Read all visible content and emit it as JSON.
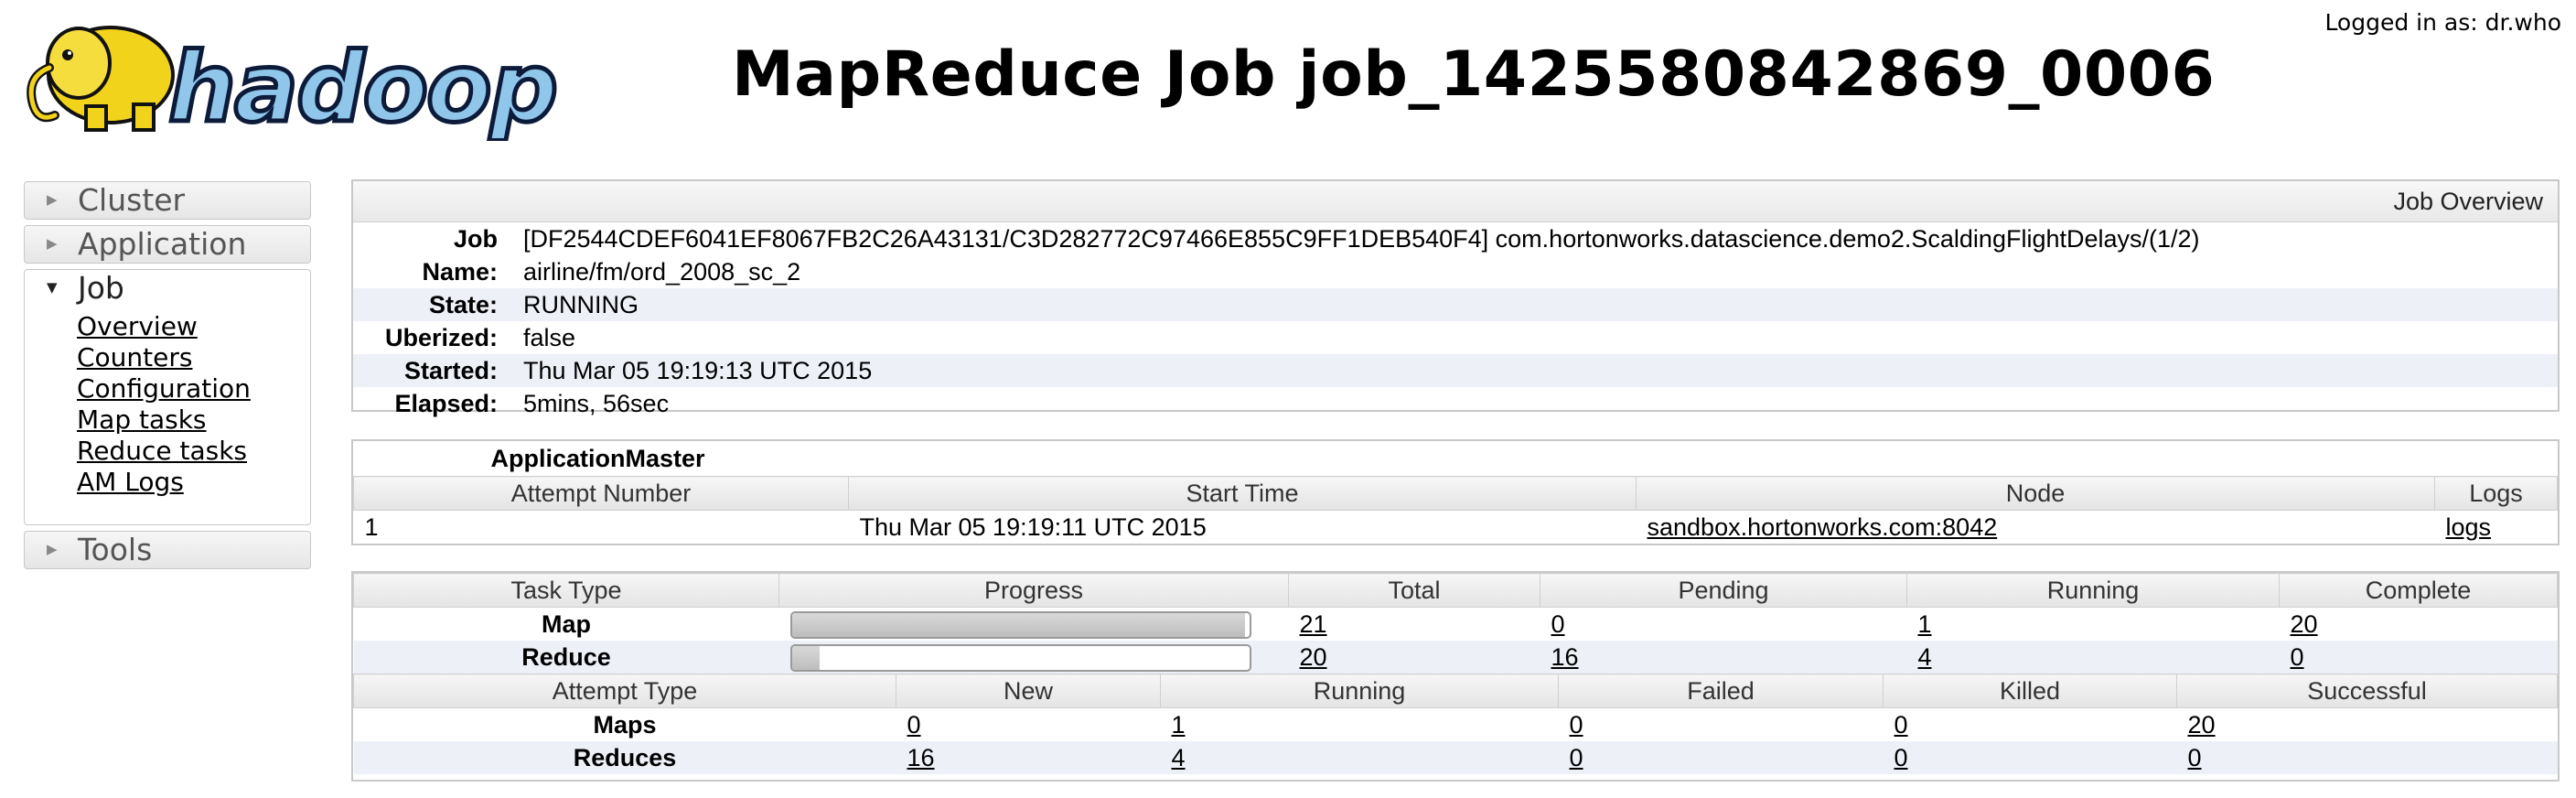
{
  "header": {
    "title": "MapReduce Job job_1425580842869_0006",
    "logged_in": "Logged in as: dr.who",
    "logo_text": "hadoop"
  },
  "nav": {
    "sections": [
      {
        "label": "Cluster",
        "expanded": false
      },
      {
        "label": "Application",
        "expanded": false
      },
      {
        "label": "Job",
        "expanded": true
      },
      {
        "label": "Tools",
        "expanded": false
      }
    ],
    "job_links": [
      "Overview",
      "Counters",
      "Configuration",
      "Map tasks",
      "Reduce tasks",
      "AM Logs"
    ]
  },
  "overview": {
    "header": "Job Overview",
    "job_label": "Job",
    "name_label": "Name:",
    "job_name_line1": "[DF2544CDEF6041EF8067FB2C26A43131/C3D282772C97466E855C9FF1DEB540F4] com.hortonworks.datascience.demo2.ScaldingFlightDelays/(1/2)",
    "job_name_line2": "airline/fm/ord_2008_sc_2",
    "rows": [
      {
        "label": "State:",
        "value": "RUNNING"
      },
      {
        "label": "Uberized:",
        "value": "false"
      },
      {
        "label": "Started:",
        "value": "Thu Mar 05 19:19:13 UTC 2015"
      },
      {
        "label": "Elapsed:",
        "value": "5mins, 56sec"
      }
    ]
  },
  "app_master": {
    "title": "ApplicationMaster",
    "columns": [
      "Attempt Number",
      "Start Time",
      "Node",
      "Logs"
    ],
    "rows": [
      {
        "attempt": "1",
        "start_time": "Thu Mar 05 19:19:11 UTC 2015",
        "node": "sandbox.hortonworks.com:8042",
        "logs": "logs"
      }
    ]
  },
  "tasks": {
    "columns": [
      "Task Type",
      "Progress",
      "Total",
      "Pending",
      "Running",
      "Complete"
    ],
    "rows": [
      {
        "type": "Map",
        "progress": 0.99,
        "total": "21",
        "pending": "0",
        "running": "1",
        "complete": "20"
      },
      {
        "type": "Reduce",
        "progress": 0.06,
        "total": "20",
        "pending": "16",
        "running": "4",
        "complete": "0"
      }
    ]
  },
  "attempts": {
    "columns": [
      "Attempt Type",
      "New",
      "Running",
      "Failed",
      "Killed",
      "Successful"
    ],
    "rows": [
      {
        "type": "Maps",
        "new": "0",
        "running": "1",
        "failed": "0",
        "killed": "0",
        "successful": "20"
      },
      {
        "type": "Reduces",
        "new": "16",
        "running": "4",
        "failed": "0",
        "killed": "0",
        "successful": "0"
      }
    ]
  },
  "colors": {
    "logo_yellow": "#f2d31b",
    "logo_blue": "#8fc6ea",
    "row_alt": "#eef0f8",
    "border": "#c8c8c8"
  }
}
